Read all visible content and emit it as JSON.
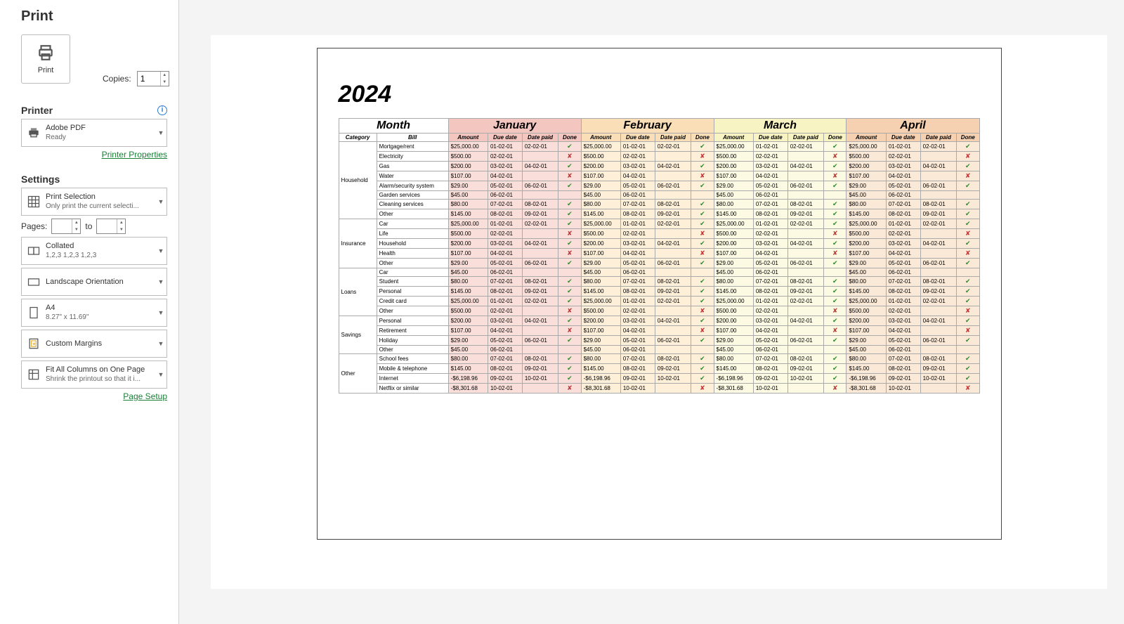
{
  "title": "Print",
  "print_button": "Print",
  "copies": {
    "label": "Copies:",
    "value": "1"
  },
  "printer": {
    "heading": "Printer",
    "name": "Adobe PDF",
    "status": "Ready",
    "properties_link": "Printer Properties"
  },
  "settings": {
    "heading": "Settings",
    "selection": {
      "l1": "Print Selection",
      "l2": "Only print the current selecti..."
    },
    "pages": {
      "label": "Pages:",
      "to": "to"
    },
    "collate": {
      "l1": "Collated",
      "l2": "1,2,3   1,2,3   1,2,3"
    },
    "orientation": {
      "l1": "Landscape Orientation"
    },
    "paper": {
      "l1": "A4",
      "l2": "8.27\" x 11.69\""
    },
    "margins": {
      "l1": "Custom Margins"
    },
    "scaling": {
      "l1": "Fit All Columns on One Page",
      "l2": "Shrink the printout so that it i..."
    },
    "page_setup": "Page Setup"
  },
  "doc": {
    "year": "2024",
    "corner": "Month",
    "headers": [
      "Category",
      "Bill"
    ],
    "subheaders": [
      "Amount",
      "Due date",
      "Date paid",
      "Done"
    ],
    "months": [
      "January",
      "February",
      "March",
      "April"
    ],
    "groups": [
      {
        "name": "Household",
        "rows": [
          {
            "bill": "Mortgage/rent",
            "cells": [
              [
                "$25,000.00",
                "01-02-01",
                "02-02-01",
                "✔"
              ],
              [
                "$25,000.00",
                "01-02-01",
                "02-02-01",
                "✔"
              ],
              [
                "$25,000.00",
                "01-02-01",
                "02-02-01",
                "✔"
              ],
              [
                "$25,000.00",
                "01-02-01",
                "02-02-01",
                "✔"
              ]
            ]
          },
          {
            "bill": "Electricity",
            "cells": [
              [
                "$500.00",
                "02-02-01",
                "",
                "✘"
              ],
              [
                "$500.00",
                "02-02-01",
                "",
                "✘"
              ],
              [
                "$500.00",
                "02-02-01",
                "",
                "✘"
              ],
              [
                "$500.00",
                "02-02-01",
                "",
                "✘"
              ]
            ]
          },
          {
            "bill": "Gas",
            "cells": [
              [
                "$200.00",
                "03-02-01",
                "04-02-01",
                "✔"
              ],
              [
                "$200.00",
                "03-02-01",
                "04-02-01",
                "✔"
              ],
              [
                "$200.00",
                "03-02-01",
                "04-02-01",
                "✔"
              ],
              [
                "$200.00",
                "03-02-01",
                "04-02-01",
                "✔"
              ]
            ]
          },
          {
            "bill": "Water",
            "cells": [
              [
                "$107.00",
                "04-02-01",
                "",
                "✘"
              ],
              [
                "$107.00",
                "04-02-01",
                "",
                "✘"
              ],
              [
                "$107.00",
                "04-02-01",
                "",
                "✘"
              ],
              [
                "$107.00",
                "04-02-01",
                "",
                "✘"
              ]
            ]
          },
          {
            "bill": "Alarm/security system",
            "cells": [
              [
                "$29.00",
                "05-02-01",
                "06-02-01",
                "✔"
              ],
              [
                "$29.00",
                "05-02-01",
                "06-02-01",
                "✔"
              ],
              [
                "$29.00",
                "05-02-01",
                "06-02-01",
                "✔"
              ],
              [
                "$29.00",
                "05-02-01",
                "06-02-01",
                "✔"
              ]
            ]
          },
          {
            "bill": "Garden services",
            "cells": [
              [
                "$45.00",
                "06-02-01",
                "",
                ""
              ],
              [
                "$45.00",
                "06-02-01",
                "",
                ""
              ],
              [
                "$45.00",
                "06-02-01",
                "",
                ""
              ],
              [
                "$45.00",
                "06-02-01",
                "",
                ""
              ]
            ]
          },
          {
            "bill": "Cleaning services",
            "cells": [
              [
                "$80.00",
                "07-02-01",
                "08-02-01",
                "✔"
              ],
              [
                "$80.00",
                "07-02-01",
                "08-02-01",
                "✔"
              ],
              [
                "$80.00",
                "07-02-01",
                "08-02-01",
                "✔"
              ],
              [
                "$80.00",
                "07-02-01",
                "08-02-01",
                "✔"
              ]
            ]
          },
          {
            "bill": "Other",
            "cells": [
              [
                "$145.00",
                "08-02-01",
                "09-02-01",
                "✔"
              ],
              [
                "$145.00",
                "08-02-01",
                "09-02-01",
                "✔"
              ],
              [
                "$145.00",
                "08-02-01",
                "09-02-01",
                "✔"
              ],
              [
                "$145.00",
                "08-02-01",
                "09-02-01",
                "✔"
              ]
            ]
          }
        ]
      },
      {
        "name": "Insurance",
        "rows": [
          {
            "bill": "Car",
            "cells": [
              [
                "$25,000.00",
                "01-02-01",
                "02-02-01",
                "✔"
              ],
              [
                "$25,000.00",
                "01-02-01",
                "02-02-01",
                "✔"
              ],
              [
                "$25,000.00",
                "01-02-01",
                "02-02-01",
                "✔"
              ],
              [
                "$25,000.00",
                "01-02-01",
                "02-02-01",
                "✔"
              ]
            ]
          },
          {
            "bill": "Life",
            "cells": [
              [
                "$500.00",
                "02-02-01",
                "",
                "✘"
              ],
              [
                "$500.00",
                "02-02-01",
                "",
                "✘"
              ],
              [
                "$500.00",
                "02-02-01",
                "",
                "✘"
              ],
              [
                "$500.00",
                "02-02-01",
                "",
                "✘"
              ]
            ]
          },
          {
            "bill": "Household",
            "cells": [
              [
                "$200.00",
                "03-02-01",
                "04-02-01",
                "✔"
              ],
              [
                "$200.00",
                "03-02-01",
                "04-02-01",
                "✔"
              ],
              [
                "$200.00",
                "03-02-01",
                "04-02-01",
                "✔"
              ],
              [
                "$200.00",
                "03-02-01",
                "04-02-01",
                "✔"
              ]
            ]
          },
          {
            "bill": "Health",
            "cells": [
              [
                "$107.00",
                "04-02-01",
                "",
                "✘"
              ],
              [
                "$107.00",
                "04-02-01",
                "",
                "✘"
              ],
              [
                "$107.00",
                "04-02-01",
                "",
                "✘"
              ],
              [
                "$107.00",
                "04-02-01",
                "",
                "✘"
              ]
            ]
          },
          {
            "bill": "Other",
            "cells": [
              [
                "$29.00",
                "05-02-01",
                "06-02-01",
                "✔"
              ],
              [
                "$29.00",
                "05-02-01",
                "06-02-01",
                "✔"
              ],
              [
                "$29.00",
                "05-02-01",
                "06-02-01",
                "✔"
              ],
              [
                "$29.00",
                "05-02-01",
                "06-02-01",
                "✔"
              ]
            ]
          }
        ]
      },
      {
        "name": "Loans",
        "rows": [
          {
            "bill": "Car",
            "cells": [
              [
                "$45.00",
                "06-02-01",
                "",
                ""
              ],
              [
                "$45.00",
                "06-02-01",
                "",
                ""
              ],
              [
                "$45.00",
                "06-02-01",
                "",
                ""
              ],
              [
                "$45.00",
                "06-02-01",
                "",
                ""
              ]
            ]
          },
          {
            "bill": "Student",
            "cells": [
              [
                "$80.00",
                "07-02-01",
                "08-02-01",
                "✔"
              ],
              [
                "$80.00",
                "07-02-01",
                "08-02-01",
                "✔"
              ],
              [
                "$80.00",
                "07-02-01",
                "08-02-01",
                "✔"
              ],
              [
                "$80.00",
                "07-02-01",
                "08-02-01",
                "✔"
              ]
            ]
          },
          {
            "bill": "Personal",
            "cells": [
              [
                "$145.00",
                "08-02-01",
                "09-02-01",
                "✔"
              ],
              [
                "$145.00",
                "08-02-01",
                "09-02-01",
                "✔"
              ],
              [
                "$145.00",
                "08-02-01",
                "09-02-01",
                "✔"
              ],
              [
                "$145.00",
                "08-02-01",
                "09-02-01",
                "✔"
              ]
            ]
          },
          {
            "bill": "Credit card",
            "cells": [
              [
                "$25,000.00",
                "01-02-01",
                "02-02-01",
                "✔"
              ],
              [
                "$25,000.00",
                "01-02-01",
                "02-02-01",
                "✔"
              ],
              [
                "$25,000.00",
                "01-02-01",
                "02-02-01",
                "✔"
              ],
              [
                "$25,000.00",
                "01-02-01",
                "02-02-01",
                "✔"
              ]
            ]
          },
          {
            "bill": "Other",
            "cells": [
              [
                "$500.00",
                "02-02-01",
                "",
                "✘"
              ],
              [
                "$500.00",
                "02-02-01",
                "",
                "✘"
              ],
              [
                "$500.00",
                "02-02-01",
                "",
                "✘"
              ],
              [
                "$500.00",
                "02-02-01",
                "",
                "✘"
              ]
            ]
          }
        ]
      },
      {
        "name": "Savings",
        "rows": [
          {
            "bill": "Personal",
            "cells": [
              [
                "$200.00",
                "03-02-01",
                "04-02-01",
                "✔"
              ],
              [
                "$200.00",
                "03-02-01",
                "04-02-01",
                "✔"
              ],
              [
                "$200.00",
                "03-02-01",
                "04-02-01",
                "✔"
              ],
              [
                "$200.00",
                "03-02-01",
                "04-02-01",
                "✔"
              ]
            ]
          },
          {
            "bill": "Retirement",
            "cells": [
              [
                "$107.00",
                "04-02-01",
                "",
                "✘"
              ],
              [
                "$107.00",
                "04-02-01",
                "",
                "✘"
              ],
              [
                "$107.00",
                "04-02-01",
                "",
                "✘"
              ],
              [
                "$107.00",
                "04-02-01",
                "",
                "✘"
              ]
            ]
          },
          {
            "bill": "Holiday",
            "cells": [
              [
                "$29.00",
                "05-02-01",
                "06-02-01",
                "✔"
              ],
              [
                "$29.00",
                "05-02-01",
                "06-02-01",
                "✔"
              ],
              [
                "$29.00",
                "05-02-01",
                "06-02-01",
                "✔"
              ],
              [
                "$29.00",
                "05-02-01",
                "06-02-01",
                "✔"
              ]
            ]
          },
          {
            "bill": "Other",
            "cells": [
              [
                "$45.00",
                "06-02-01",
                "",
                ""
              ],
              [
                "$45.00",
                "06-02-01",
                "",
                ""
              ],
              [
                "$45.00",
                "06-02-01",
                "",
                ""
              ],
              [
                "$45.00",
                "06-02-01",
                "",
                ""
              ]
            ]
          }
        ]
      },
      {
        "name": "Other",
        "rows": [
          {
            "bill": "School fees",
            "cells": [
              [
                "$80.00",
                "07-02-01",
                "08-02-01",
                "✔"
              ],
              [
                "$80.00",
                "07-02-01",
                "08-02-01",
                "✔"
              ],
              [
                "$80.00",
                "07-02-01",
                "08-02-01",
                "✔"
              ],
              [
                "$80.00",
                "07-02-01",
                "08-02-01",
                "✔"
              ]
            ]
          },
          {
            "bill": "Mobile & telephone",
            "cells": [
              [
                "$145.00",
                "08-02-01",
                "09-02-01",
                "✔"
              ],
              [
                "$145.00",
                "08-02-01",
                "09-02-01",
                "✔"
              ],
              [
                "$145.00",
                "08-02-01",
                "09-02-01",
                "✔"
              ],
              [
                "$145.00",
                "08-02-01",
                "09-02-01",
                "✔"
              ]
            ]
          },
          {
            "bill": "Internet",
            "cells": [
              [
                "-$6,198.96",
                "09-02-01",
                "10-02-01",
                "✔"
              ],
              [
                "-$6,198.96",
                "09-02-01",
                "10-02-01",
                "✔"
              ],
              [
                "-$6,198.96",
                "09-02-01",
                "10-02-01",
                "✔"
              ],
              [
                "-$6,198.96",
                "09-02-01",
                "10-02-01",
                "✔"
              ]
            ]
          },
          {
            "bill": "Netflix or similar",
            "cells": [
              [
                "-$8,301.68",
                "10-02-01",
                "",
                "✘"
              ],
              [
                "-$8,301.68",
                "10-02-01",
                "",
                "✘"
              ],
              [
                "-$8,301.68",
                "10-02-01",
                "",
                "✘"
              ],
              [
                "-$8,301.68",
                "10-02-01",
                "",
                "✘"
              ]
            ]
          }
        ]
      }
    ]
  }
}
